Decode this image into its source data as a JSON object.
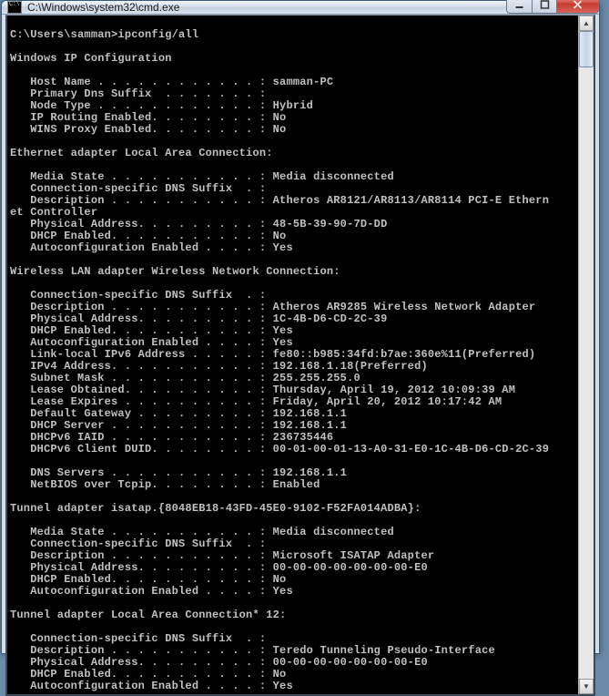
{
  "window": {
    "title": "C:\\Windows\\system32\\cmd.exe"
  },
  "prompt": {
    "path": "C:\\Users\\samman>",
    "command": "ipconfig/all"
  },
  "header": "Windows IP Configuration",
  "ipconfig": {
    "host_name_label": "   Host Name . . . . . . . . . . . . : ",
    "host_name": "samman-PC",
    "primary_dns_suffix_label": "   Primary Dns Suffix  . . . . . . . :",
    "node_type_label": "   Node Type . . . . . . . . . . . . : ",
    "node_type": "Hybrid",
    "ip_routing_label": "   IP Routing Enabled. . . . . . . . : ",
    "ip_routing": "No",
    "wins_proxy_label": "   WINS Proxy Enabled. . . . . . . . : ",
    "wins_proxy": "No"
  },
  "eth": {
    "title": "Ethernet adapter Local Area Connection:",
    "media_state_label": "   Media State . . . . . . . . . . . : ",
    "media_state": "Media disconnected",
    "dns_suffix_label": "   Connection-specific DNS Suffix  . :",
    "desc_label": "   Description . . . . . . . . . . . : ",
    "desc": "Atheros AR8121/AR8113/AR8114 PCI-E Ethern",
    "desc_wrap": "et Controller",
    "phys_label": "   Physical Address. . . . . . . . . : ",
    "phys": "48-5B-39-90-7D-DD",
    "dhcp_label": "   DHCP Enabled. . . . . . . . . . . : ",
    "dhcp": "No",
    "autoconf_label": "   Autoconfiguration Enabled . . . . : ",
    "autoconf": "Yes"
  },
  "wlan": {
    "title": "Wireless LAN adapter Wireless Network Connection:",
    "dns_suffix_label": "   Connection-specific DNS Suffix  . :",
    "desc_label": "   Description . . . . . . . . . . . : ",
    "desc": "Atheros AR9285 Wireless Network Adapter",
    "phys_label": "   Physical Address. . . . . . . . . : ",
    "phys": "1C-4B-D6-CD-2C-39",
    "dhcp_label": "   DHCP Enabled. . . . . . . . . . . : ",
    "dhcp": "Yes",
    "autoconf_label": "   Autoconfiguration Enabled . . . . : ",
    "autoconf": "Yes",
    "llipv6_label": "   Link-local IPv6 Address . . . . . : ",
    "llipv6": "fe80::b985:34fd:b7ae:360e%11(Preferred)",
    "ipv4_label": "   IPv4 Address. . . . . . . . . . . : ",
    "ipv4": "192.168.1.18(Preferred)",
    "subnet_label": "   Subnet Mask . . . . . . . . . . . : ",
    "subnet": "255.255.255.0",
    "lease_obt_label": "   Lease Obtained. . . . . . . . . . : ",
    "lease_obt": "Thursday, April 19, 2012 10:09:39 AM",
    "lease_exp_label": "   Lease Expires . . . . . . . . . . : ",
    "lease_exp": "Friday, April 20, 2012 10:17:42 AM",
    "gateway_label": "   Default Gateway . . . . . . . . . : ",
    "gateway": "192.168.1.1",
    "dhcpsrv_label": "   DHCP Server . . . . . . . . . . . : ",
    "dhcpsrv": "192.168.1.1",
    "iaid_label": "   DHCPv6 IAID . . . . . . . . . . . : ",
    "iaid": "236735446",
    "duid_label": "   DHCPv6 Client DUID. . . . . . . . : ",
    "duid": "00-01-00-01-13-A0-31-E0-1C-4B-D6-CD-2C-39",
    "dns_label": "   DNS Servers . . . . . . . . . . . : ",
    "dns": "192.168.1.1",
    "netbios_label": "   NetBIOS over Tcpip. . . . . . . . : ",
    "netbios": "Enabled"
  },
  "tun1": {
    "title": "Tunnel adapter isatap.{8048EB18-43FD-45E0-9102-F52FA014ADBA}:",
    "media_state_label": "   Media State . . . . . . . . . . . : ",
    "media_state": "Media disconnected",
    "dns_suffix_label": "   Connection-specific DNS Suffix  . :",
    "desc_label": "   Description . . . . . . . . . . . : ",
    "desc": "Microsoft ISATAP Adapter",
    "phys_label": "   Physical Address. . . . . . . . . : ",
    "phys": "00-00-00-00-00-00-00-E0",
    "dhcp_label": "   DHCP Enabled. . . . . . . . . . . : ",
    "dhcp": "No",
    "autoconf_label": "   Autoconfiguration Enabled . . . . : ",
    "autoconf": "Yes"
  },
  "tun2": {
    "title": "Tunnel adapter Local Area Connection* 12:",
    "dns_suffix_label": "   Connection-specific DNS Suffix  . :",
    "desc_label": "   Description . . . . . . . . . . . : ",
    "desc": "Teredo Tunneling Pseudo-Interface",
    "phys_label": "   Physical Address. . . . . . . . . : ",
    "phys": "00-00-00-00-00-00-00-E0",
    "dhcp_label": "   DHCP Enabled. . . . . . . . . . . : ",
    "dhcp": "No",
    "autoconf_label": "   Autoconfiguration Enabled . . . . : ",
    "autoconf": "Yes"
  }
}
